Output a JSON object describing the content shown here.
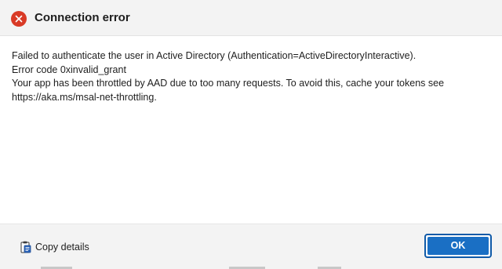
{
  "dialog": {
    "title": "Connection error",
    "icon": "error-circle-icon",
    "accent_color": "#d93a26",
    "message_lines": [
      "Failed to authenticate the user in Active Directory (Authentication=ActiveDirectoryInteractive).",
      "Error code 0xinvalid_grant",
      "Your app has been throttled by AAD due to too many requests. To avoid this, cache your tokens see",
      "https://aka.ms/msal-net-throttling."
    ]
  },
  "footer": {
    "copy_details_label": "Copy details",
    "copy_icon": "clipboard-icon",
    "ok_label": "OK",
    "ok_color": "#1a6fc4"
  }
}
